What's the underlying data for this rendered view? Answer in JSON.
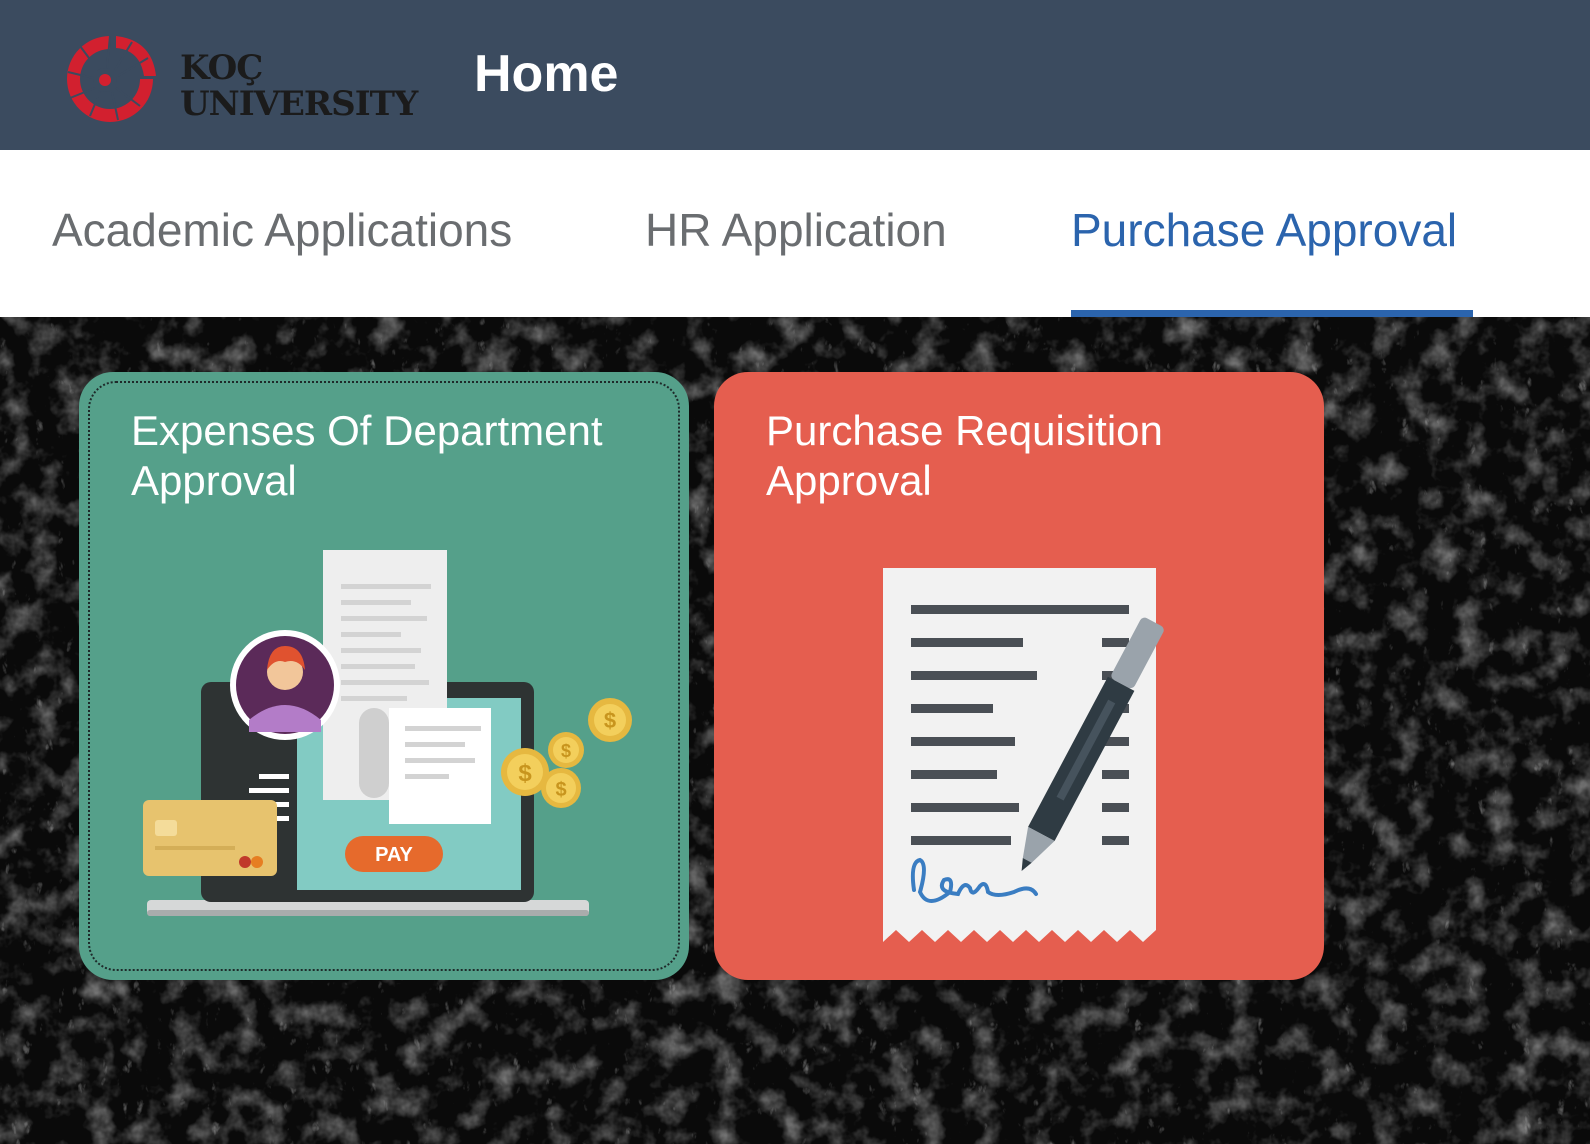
{
  "header": {
    "logo_line1": "KOÇ",
    "logo_line2": "UNIVERSITY",
    "title": "Home"
  },
  "tabs": [
    {
      "label": "Academic Applications",
      "selected": false
    },
    {
      "label": "HR Application",
      "selected": false
    },
    {
      "label": "Purchase Approval",
      "selected": true
    }
  ],
  "tiles": [
    {
      "title_line1": "Expenses Of Department",
      "title_line2": "Approval",
      "illustration_text": "PAY",
      "icon": "laptop-payment-illustration",
      "color": "#55a08a",
      "focused": true
    },
    {
      "title_line1": "Purchase Requisition",
      "title_line2": "Approval",
      "icon": "receipt-signature-illustration",
      "color": "#e55e4f",
      "focused": false
    }
  ],
  "colors": {
    "header_bg": "#3b4b5f",
    "tab_active": "#2b64ad",
    "tab_inactive": "#6a6d70",
    "logo_red": "#d2202f"
  }
}
